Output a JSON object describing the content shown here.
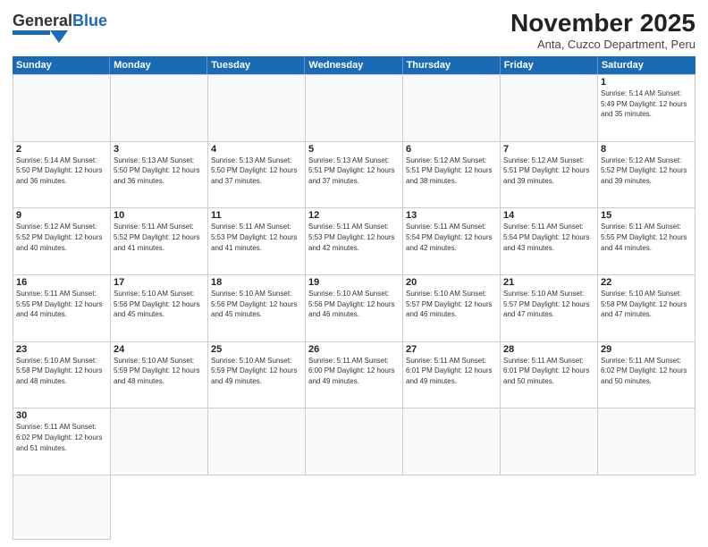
{
  "header": {
    "logo": {
      "general": "General",
      "blue": "Blue"
    },
    "title": "November 2025",
    "subtitle": "Anta, Cuzco Department, Peru"
  },
  "calendar": {
    "days": [
      "Sunday",
      "Monday",
      "Tuesday",
      "Wednesday",
      "Thursday",
      "Friday",
      "Saturday"
    ],
    "cells": [
      {
        "day": null,
        "info": ""
      },
      {
        "day": null,
        "info": ""
      },
      {
        "day": null,
        "info": ""
      },
      {
        "day": null,
        "info": ""
      },
      {
        "day": null,
        "info": ""
      },
      {
        "day": null,
        "info": ""
      },
      {
        "day": "1",
        "info": "Sunrise: 5:14 AM\nSunset: 5:49 PM\nDaylight: 12 hours and 35 minutes."
      },
      {
        "day": "2",
        "info": "Sunrise: 5:14 AM\nSunset: 5:50 PM\nDaylight: 12 hours and 36 minutes."
      },
      {
        "day": "3",
        "info": "Sunrise: 5:13 AM\nSunset: 5:50 PM\nDaylight: 12 hours and 36 minutes."
      },
      {
        "day": "4",
        "info": "Sunrise: 5:13 AM\nSunset: 5:50 PM\nDaylight: 12 hours and 37 minutes."
      },
      {
        "day": "5",
        "info": "Sunrise: 5:13 AM\nSunset: 5:51 PM\nDaylight: 12 hours and 37 minutes."
      },
      {
        "day": "6",
        "info": "Sunrise: 5:12 AM\nSunset: 5:51 PM\nDaylight: 12 hours and 38 minutes."
      },
      {
        "day": "7",
        "info": "Sunrise: 5:12 AM\nSunset: 5:51 PM\nDaylight: 12 hours and 39 minutes."
      },
      {
        "day": "8",
        "info": "Sunrise: 5:12 AM\nSunset: 5:52 PM\nDaylight: 12 hours and 39 minutes."
      },
      {
        "day": "9",
        "info": "Sunrise: 5:12 AM\nSunset: 5:52 PM\nDaylight: 12 hours and 40 minutes."
      },
      {
        "day": "10",
        "info": "Sunrise: 5:11 AM\nSunset: 5:52 PM\nDaylight: 12 hours and 41 minutes."
      },
      {
        "day": "11",
        "info": "Sunrise: 5:11 AM\nSunset: 5:53 PM\nDaylight: 12 hours and 41 minutes."
      },
      {
        "day": "12",
        "info": "Sunrise: 5:11 AM\nSunset: 5:53 PM\nDaylight: 12 hours and 42 minutes."
      },
      {
        "day": "13",
        "info": "Sunrise: 5:11 AM\nSunset: 5:54 PM\nDaylight: 12 hours and 42 minutes."
      },
      {
        "day": "14",
        "info": "Sunrise: 5:11 AM\nSunset: 5:54 PM\nDaylight: 12 hours and 43 minutes."
      },
      {
        "day": "15",
        "info": "Sunrise: 5:11 AM\nSunset: 5:55 PM\nDaylight: 12 hours and 44 minutes."
      },
      {
        "day": "16",
        "info": "Sunrise: 5:11 AM\nSunset: 5:55 PM\nDaylight: 12 hours and 44 minutes."
      },
      {
        "day": "17",
        "info": "Sunrise: 5:10 AM\nSunset: 5:56 PM\nDaylight: 12 hours and 45 minutes."
      },
      {
        "day": "18",
        "info": "Sunrise: 5:10 AM\nSunset: 5:56 PM\nDaylight: 12 hours and 45 minutes."
      },
      {
        "day": "19",
        "info": "Sunrise: 5:10 AM\nSunset: 5:56 PM\nDaylight: 12 hours and 46 minutes."
      },
      {
        "day": "20",
        "info": "Sunrise: 5:10 AM\nSunset: 5:57 PM\nDaylight: 12 hours and 46 minutes."
      },
      {
        "day": "21",
        "info": "Sunrise: 5:10 AM\nSunset: 5:57 PM\nDaylight: 12 hours and 47 minutes."
      },
      {
        "day": "22",
        "info": "Sunrise: 5:10 AM\nSunset: 5:58 PM\nDaylight: 12 hours and 47 minutes."
      },
      {
        "day": "23",
        "info": "Sunrise: 5:10 AM\nSunset: 5:58 PM\nDaylight: 12 hours and 48 minutes."
      },
      {
        "day": "24",
        "info": "Sunrise: 5:10 AM\nSunset: 5:59 PM\nDaylight: 12 hours and 48 minutes."
      },
      {
        "day": "25",
        "info": "Sunrise: 5:10 AM\nSunset: 5:59 PM\nDaylight: 12 hours and 49 minutes."
      },
      {
        "day": "26",
        "info": "Sunrise: 5:11 AM\nSunset: 6:00 PM\nDaylight: 12 hours and 49 minutes."
      },
      {
        "day": "27",
        "info": "Sunrise: 5:11 AM\nSunset: 6:01 PM\nDaylight: 12 hours and 49 minutes."
      },
      {
        "day": "28",
        "info": "Sunrise: 5:11 AM\nSunset: 6:01 PM\nDaylight: 12 hours and 50 minutes."
      },
      {
        "day": "29",
        "info": "Sunrise: 5:11 AM\nSunset: 6:02 PM\nDaylight: 12 hours and 50 minutes."
      },
      {
        "day": "30",
        "info": "Sunrise: 5:11 AM\nSunset: 6:02 PM\nDaylight: 12 hours and 51 minutes."
      },
      {
        "day": null,
        "info": ""
      },
      {
        "day": null,
        "info": ""
      },
      {
        "day": null,
        "info": ""
      },
      {
        "day": null,
        "info": ""
      },
      {
        "day": null,
        "info": ""
      },
      {
        "day": null,
        "info": ""
      },
      {
        "day": null,
        "info": ""
      }
    ]
  }
}
